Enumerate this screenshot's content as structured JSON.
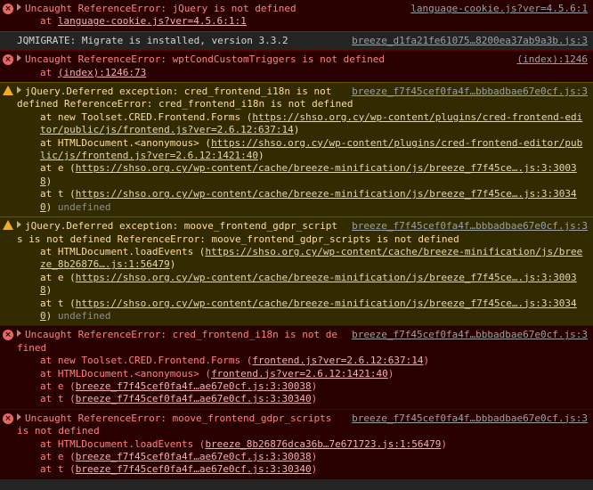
{
  "messages": {
    "m1": {
      "source": "language-cookie.js?ver=4.5.6:1",
      "text": "Uncaught ReferenceError: jQuery is not defined",
      "at": "at",
      "link": "language-cookie.js?ver=4.5.6:1:1"
    },
    "m2": {
      "source": "breeze_d1fa21fe61075…8200ea37ab9a3b.js:3",
      "text": "JQMIGRATE: Migrate is installed, version 3.3.2"
    },
    "m3": {
      "source": "(index):1246",
      "text": "Uncaught ReferenceError: wptCondCustomTriggers is not defined",
      "at": "at",
      "link": "(index):1246:73"
    },
    "m4": {
      "source": "breeze_f7f45cef0fa4f…bbbadbae67e0cf.js:3",
      "text": "jQuery.Deferred exception: cred_frontend_i18n is not defined ReferenceError: cred_frontend_i18n is not defined",
      "s1_pre": "at new Toolset.CRED.Frontend.Forms (",
      "s1_link": "https://shso.org.cy/wp-content/plugins/cred-frontend-editor/public/js/frontend.js?ver=2.6.12:637:14",
      "s2_pre": "at HTMLDocument.<anonymous> (",
      "s2_link": "https://shso.org.cy/wp-content/plugins/cred-frontend-editor/public/js/frontend.js?ver=2.6.12:1421:40",
      "s3_pre": "at e (",
      "s3_link": "https://shso.org.cy/wp-content/cache/breeze-minification/js/breeze_f7f45ce….js:3:30038",
      "s4_pre": "at t (",
      "s4_link": "https://shso.org.cy/wp-content/cache/breeze-minification/js/breeze_f7f45ce….js:3:30340",
      "undef": "undefined"
    },
    "m5": {
      "source": "breeze_f7f45cef0fa4f…bbbadbae67e0cf.js:3",
      "text": "jQuery.Deferred exception: moove_frontend_gdpr_scripts is not defined ReferenceError: moove_frontend_gdpr_scripts is not defined",
      "s1_pre": "at HTMLDocument.loadEvents (",
      "s1_link": "https://shso.org.cy/wp-content/cache/breeze-minification/js/breeze_8b26876….js:1:56479",
      "s2_pre": "at e (",
      "s2_link": "https://shso.org.cy/wp-content/cache/breeze-minification/js/breeze_f7f45ce….js:3:30038",
      "s3_pre": "at t (",
      "s3_link": "https://shso.org.cy/wp-content/cache/breeze-minification/js/breeze_f7f45ce….js:3:30340",
      "undef": "undefined"
    },
    "m6": {
      "source": "breeze_f7f45cef0fa4f…bbbadbae67e0cf.js:3",
      "text": "Uncaught ReferenceError: cred_frontend_i18n is not defined",
      "s1_pre": "at new Toolset.CRED.Frontend.Forms (",
      "s1_link": "frontend.js?ver=2.6.12:637:14",
      "s2_pre": "at HTMLDocument.<anonymous> (",
      "s2_link": "frontend.js?ver=2.6.12:1421:40",
      "s3_pre": "at e (",
      "s3_link": "breeze_f7f45cef0fa4f…ae67e0cf.js:3:30038",
      "s4_pre": "at t (",
      "s4_link": "breeze_f7f45cef0fa4f…ae67e0cf.js:3:30340"
    },
    "m7": {
      "source": "breeze_f7f45cef0fa4f…bbbadbae67e0cf.js:3",
      "text": "Uncaught ReferenceError: moove_frontend_gdpr_scripts is not defined",
      "s1_pre": "at HTMLDocument.loadEvents (",
      "s1_link": "breeze_8b26876dca36b…7e671723.js:1:56479",
      "s2_pre": "at e (",
      "s2_link": "breeze_f7f45cef0fa4f…ae67e0cf.js:3:30038",
      "s3_pre": "at t (",
      "s3_link": "breeze_f7f45cef0fa4f…ae67e0cf.js:3:30340"
    }
  },
  "close_paren": ")",
  "icons": {
    "error": "×",
    "warning": "!"
  }
}
